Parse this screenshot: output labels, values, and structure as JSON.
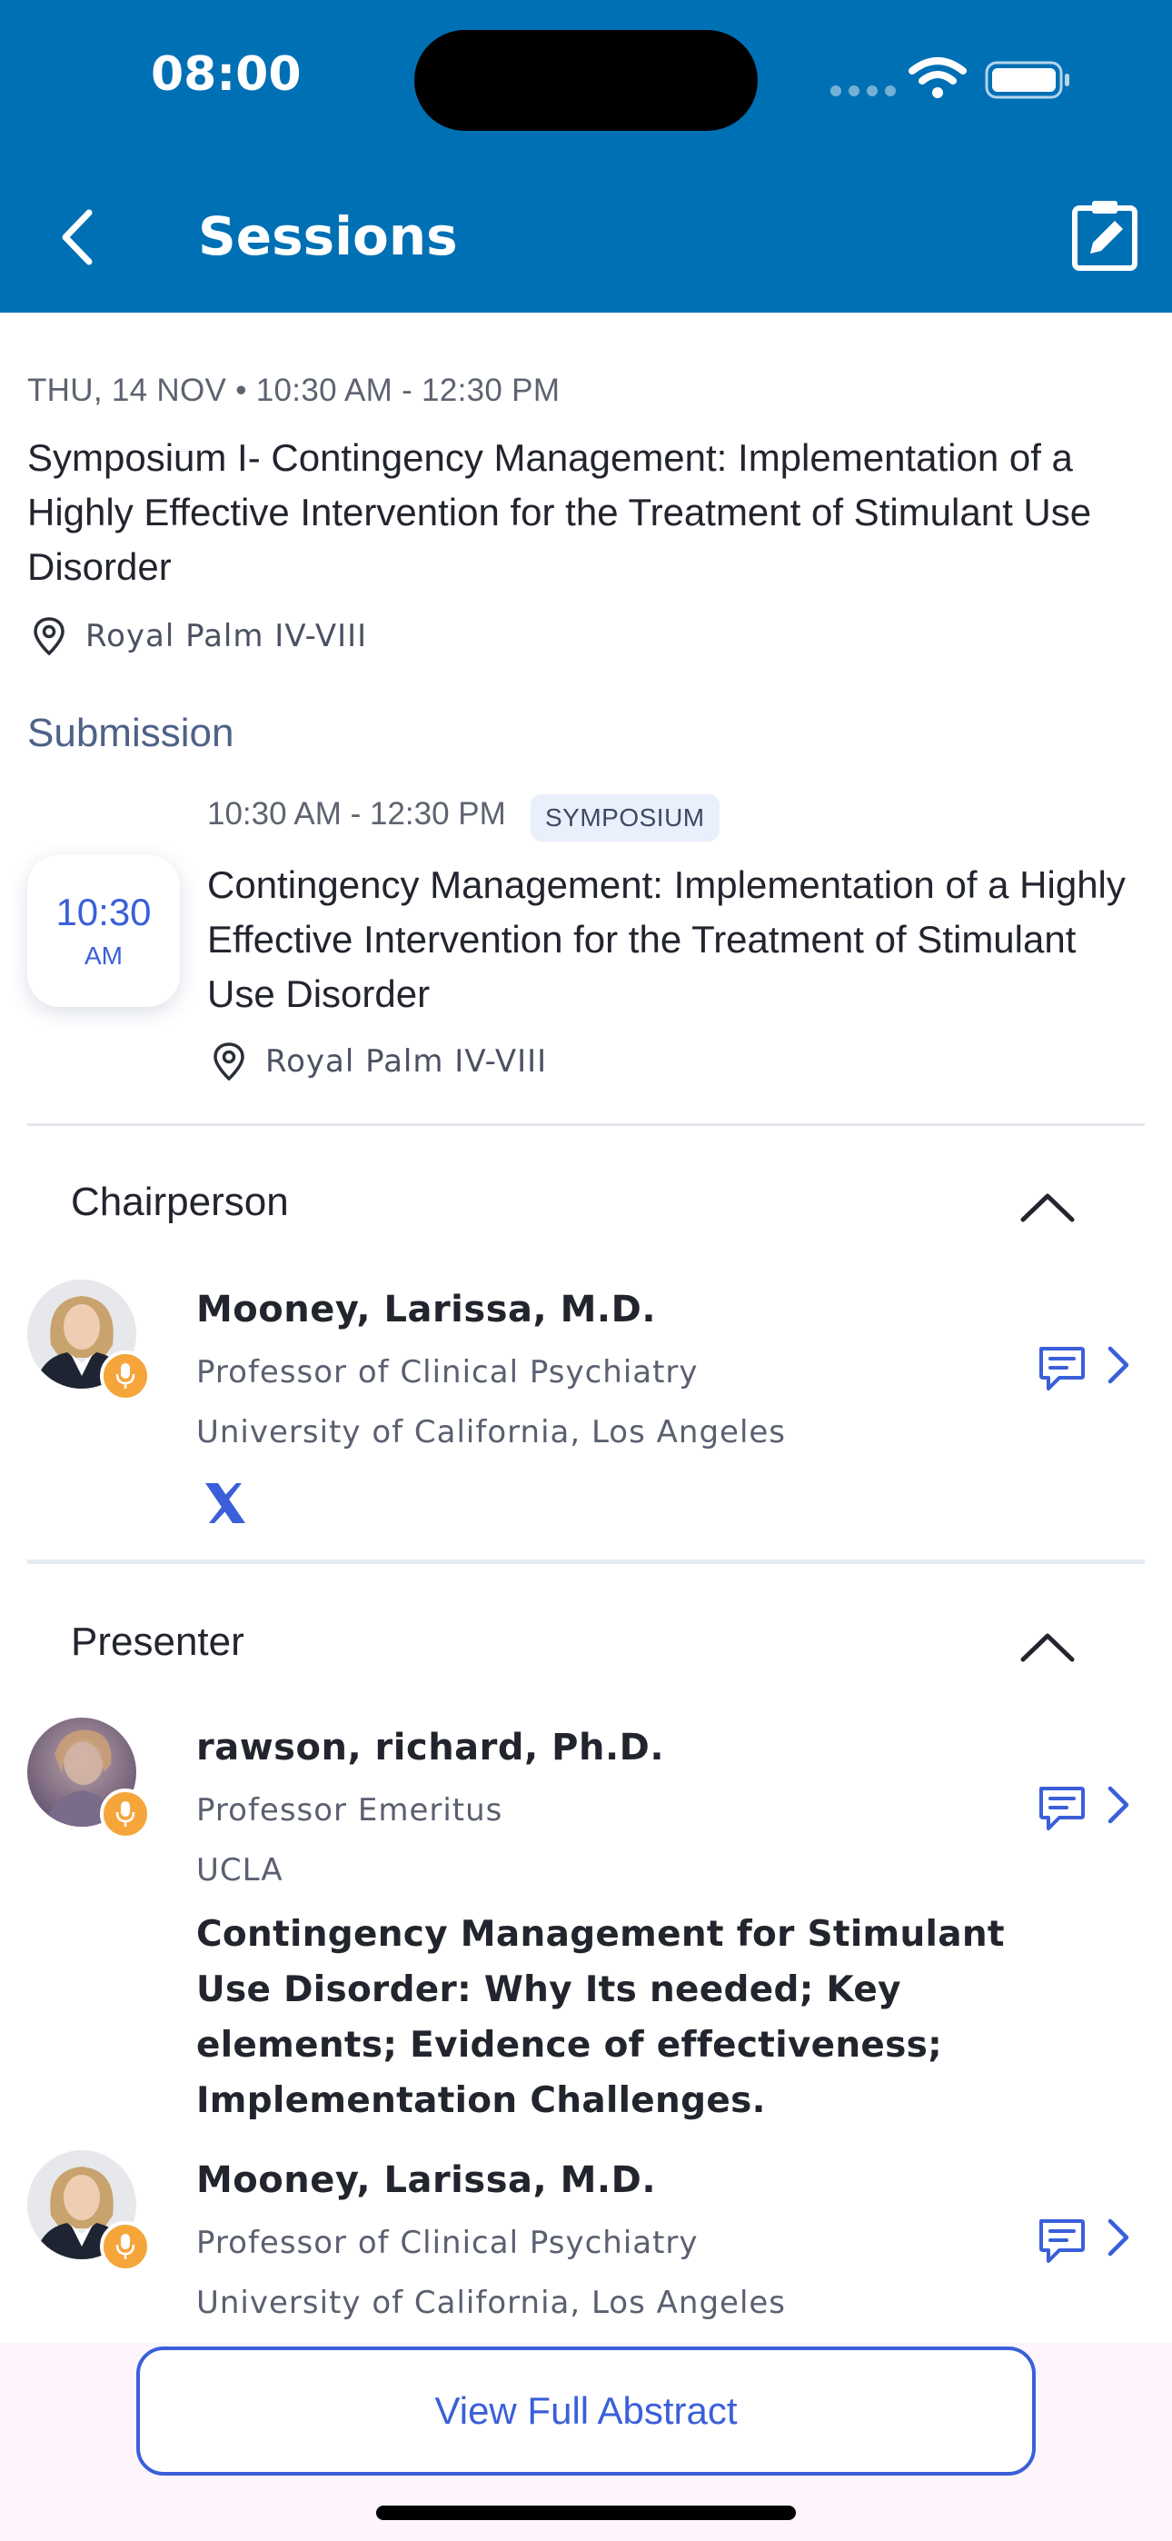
{
  "status_bar": {
    "time": "08:00"
  },
  "nav": {
    "title": "Sessions"
  },
  "session": {
    "date_time": "THU, 14 NOV • 10:30 AM - 12:30 PM",
    "title": "Symposium I- Contingency Management: Implementation of a Highly Effective Intervention for the Treatment of Stimulant Use Disorder",
    "location": "Royal Palm IV-VIII"
  },
  "submission": {
    "section_label": "Submission",
    "card_time": "10:30",
    "card_ampm": "AM",
    "time_range": "10:30 AM - 12:30 PM",
    "tag": "SYMPOSIUM",
    "title": "Contingency Management: Implementation of a Highly Effective Intervention for the Treatment of Stimulant Use Disorder",
    "location": "Royal Palm IV-VIII"
  },
  "chairperson": {
    "heading": "Chairperson",
    "people": [
      {
        "name": "Mooney, Larissa, M.D.",
        "title": "Professor of Clinical Psychiatry",
        "org": "University of California, Los Angeles"
      }
    ]
  },
  "presenter": {
    "heading": "Presenter",
    "people": [
      {
        "name": "rawson, richard, Ph.D.",
        "title": "Professor Emeritus",
        "org": "UCLA",
        "talk": "Contingency Management for Stimulant Use Disorder: Why Its needed; Key elements; Evidence of effectiveness; Implementation Challenges."
      },
      {
        "name": "Mooney, Larissa, M.D.",
        "title": "Professor of Clinical Psychiatry",
        "org": "University of California, Los Angeles"
      }
    ]
  },
  "footer": {
    "abstract_button": "View Full Abstract"
  },
  "colors": {
    "header": "#0070b5",
    "accent": "#3a5fd9",
    "mic_badge": "#f6a53b"
  },
  "icons": [
    "back-icon",
    "edit-icon",
    "location-pin-icon",
    "chevron-up-icon",
    "mic-icon",
    "x-social-icon",
    "chat-icon",
    "chevron-right-icon",
    "wifi-icon",
    "battery-icon"
  ]
}
